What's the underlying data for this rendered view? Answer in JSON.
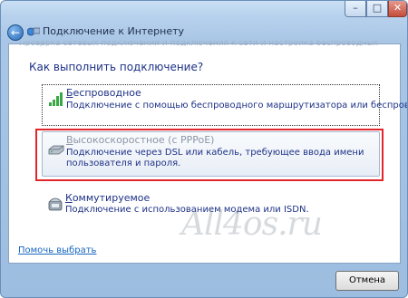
{
  "window": {
    "title": "Подключение к Интернету",
    "ghost_text": "Проверка сетевых подключений и подключения к сети и настройка беспроводных сетей"
  },
  "page": {
    "heading": "Как выполнить подключение?",
    "options": [
      {
        "title_first": "Б",
        "title_rest": "еспроводное",
        "description": "Подключение с помощью беспроводного маршрутизатора или беспроводной сети.",
        "icon": "wireless-signal-icon"
      },
      {
        "title_first": "В",
        "title_rest": "ысокоскоростное (с PPPoE)",
        "description": "Подключение через DSL или кабель, требующее ввода имени пользователя и пароля.",
        "icon": "broadband-modem-icon"
      },
      {
        "title_first": "К",
        "title_rest": "оммутируемое",
        "description": "Подключение с использованием модема или ISDN.",
        "icon": "dialup-phone-icon"
      }
    ],
    "help_link": "Помочь выбрать",
    "watermark": "All4os.ru"
  },
  "footer": {
    "cancel_label": "Отмена"
  },
  "colors": {
    "highlight": "#e3262c",
    "link": "#1565c0",
    "heading": "#1e3287"
  }
}
